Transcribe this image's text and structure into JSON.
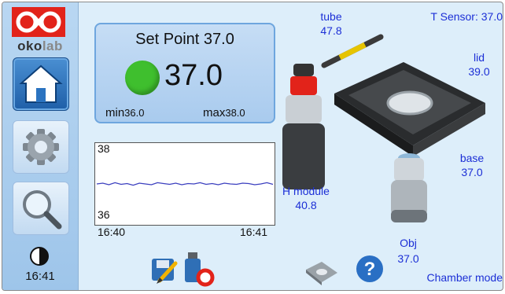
{
  "brand": {
    "name_ok": "oko",
    "name_lab": "lab"
  },
  "sidebar": {
    "clock": "16:41"
  },
  "setpoint": {
    "title": "Set Point 37.0",
    "current_value": "37.0",
    "min_label": "min",
    "min_value": "36.0",
    "max_label": "max",
    "max_value": "38.0",
    "status_color": "#3fbf2e"
  },
  "chart_data": {
    "type": "line",
    "x_tick_labels": [
      "16:40",
      "16:41"
    ],
    "y_tick_labels": [
      "38",
      "36"
    ],
    "ylim": [
      36,
      38
    ],
    "series": [
      {
        "values": [
          37.0,
          37.02,
          36.98,
          37.03,
          36.99,
          37.01,
          36.97,
          37.02,
          37.0,
          36.98,
          37.03,
          37.01,
          36.99,
          37.02,
          36.98,
          37.01,
          37.0,
          37.03,
          36.99,
          37.01,
          36.98,
          37.02,
          37.0,
          36.99,
          37.02,
          37.01,
          36.98,
          37.0,
          37.03,
          36.99
        ]
      }
    ],
    "line_color": "#3b3fbf"
  },
  "diagram": {
    "tube_label": "tube",
    "tube_value": "47.8",
    "t_sensor": "T Sensor: 37.0",
    "lid_label": "lid",
    "lid_value": "39.0",
    "base_label": "base",
    "base_value": "37.0",
    "h_module_label": "H module",
    "h_module_value": "40.8",
    "obj_label": "Obj",
    "obj_value": "37.0",
    "chamber_mode": "Chamber mode"
  },
  "colors": {
    "label_blue": "#1c2fd6",
    "panel_blue": "#a9cbee",
    "logo_red": "#e2231a"
  }
}
